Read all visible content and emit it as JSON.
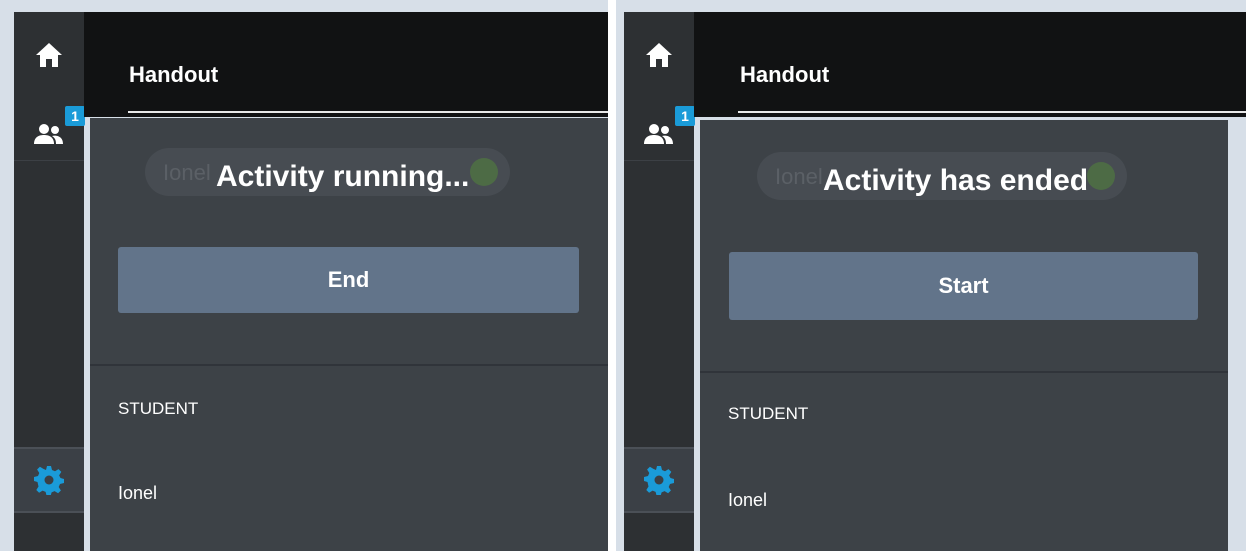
{
  "screens": [
    {
      "sidebar": {
        "badge_count": "1"
      },
      "header": {
        "title": "Handout"
      },
      "ghost_student": "Ionel",
      "status": "Activity running...",
      "action_label": "End",
      "section_label": "STUDENT",
      "student": "Ionel"
    },
    {
      "sidebar": {
        "badge_count": "1"
      },
      "header": {
        "title": "Handout"
      },
      "ghost_student": "Ionel",
      "status": "Activity has ended",
      "action_label": "Start",
      "section_label": "STUDENT",
      "student": "Ionel"
    }
  ],
  "colors": {
    "sidebar": "#2d3033",
    "topbar": "#111213",
    "panel": "#3d4247",
    "button": "#62748a",
    "badge": "#1a9bd8",
    "settings_icon": "#1a9bd8"
  },
  "icons": [
    "home-icon",
    "people-icon",
    "gear-icon"
  ]
}
